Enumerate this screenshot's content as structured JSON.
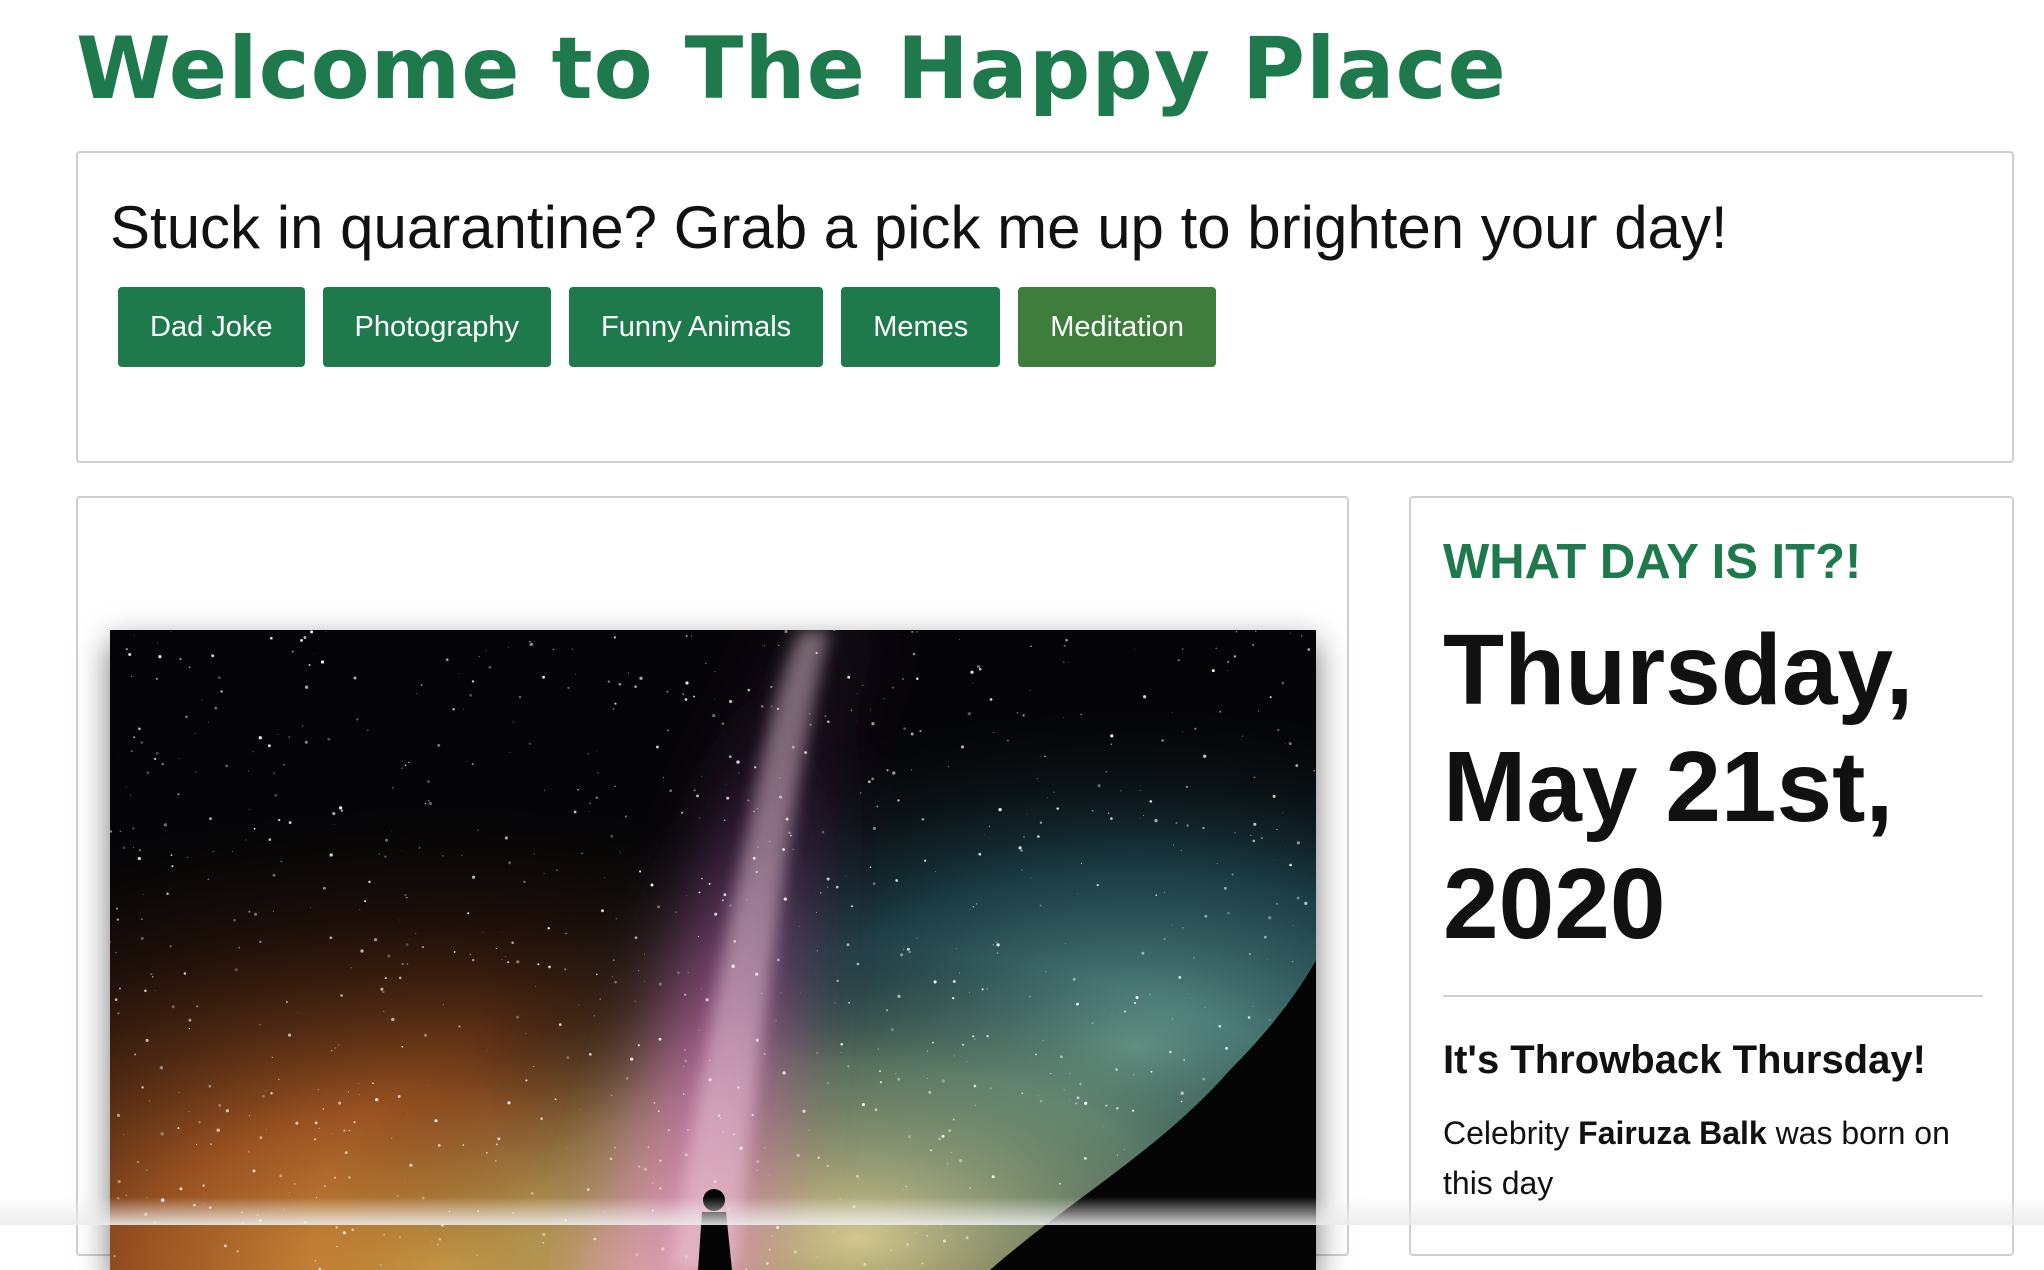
{
  "header": {
    "title": "Welcome to The Happy Place"
  },
  "intro": {
    "tagline": "Stuck in quarantine? Grab a pick me up to brighten your day!",
    "buttons": [
      {
        "label": "Dad Joke"
      },
      {
        "label": "Photography"
      },
      {
        "label": "Funny Animals"
      },
      {
        "label": "Memes"
      },
      {
        "label": "Meditation",
        "active": true
      }
    ]
  },
  "photo": {
    "subject": "milky-way-night-sky"
  },
  "day": {
    "kicker": "WHAT DAY IS IT?!",
    "date": "Thursday, May 21st, 2020",
    "subhead": "It's Throwback Thursday!",
    "body_prefix": "Celebrity ",
    "celebrity": "Fairuza Balk",
    "body_suffix": " was born on this day"
  },
  "colors": {
    "brand_green": "#1e7a4c",
    "active_button": "#3e7d3c",
    "card_border": "#cfcfcf"
  }
}
